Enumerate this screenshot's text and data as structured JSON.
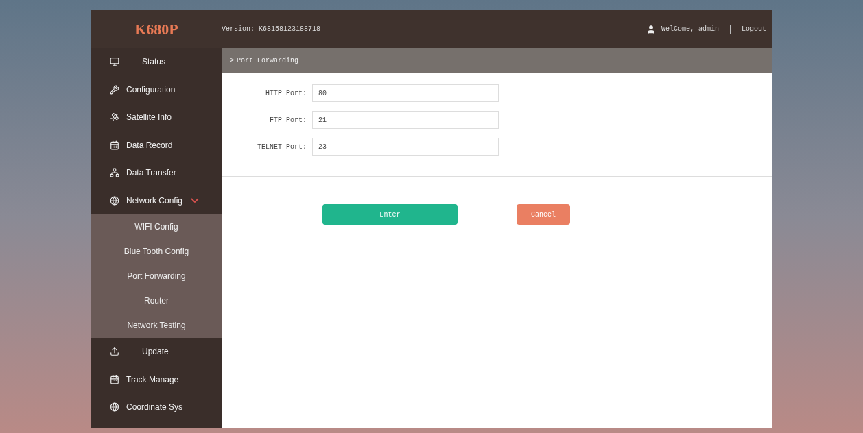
{
  "header": {
    "logo": "K680P",
    "version": "Version: K68158123188718",
    "welcome": "WelCome, admin",
    "logout": "Logout"
  },
  "sidebar": {
    "items": [
      {
        "label": "Status"
      },
      {
        "label": "Configuration"
      },
      {
        "label": "Satellite Info"
      },
      {
        "label": "Data Record"
      },
      {
        "label": "Data Transfer"
      },
      {
        "label": "Network Config",
        "expanded": true,
        "children": [
          {
            "label": "WIFI Config"
          },
          {
            "label": "Blue Tooth Config"
          },
          {
            "label": "Port Forwarding"
          },
          {
            "label": "Router"
          },
          {
            "label": "Network Testing"
          }
        ]
      },
      {
        "label": "Update"
      },
      {
        "label": "Track Manage"
      },
      {
        "label": "Coordinate Sys"
      }
    ]
  },
  "breadcrumb": {
    "mark": ">",
    "label": "Port Forwarding"
  },
  "form": {
    "fields": [
      {
        "label": "HTTP Port:",
        "value": "80"
      },
      {
        "label": "FTP Port:",
        "value": "21"
      },
      {
        "label": "TELNET Port:",
        "value": "23"
      }
    ]
  },
  "buttons": [
    {
      "label": "Enter",
      "kind": "primary"
    },
    {
      "label": "Cancel",
      "kind": "cancel"
    }
  ]
}
